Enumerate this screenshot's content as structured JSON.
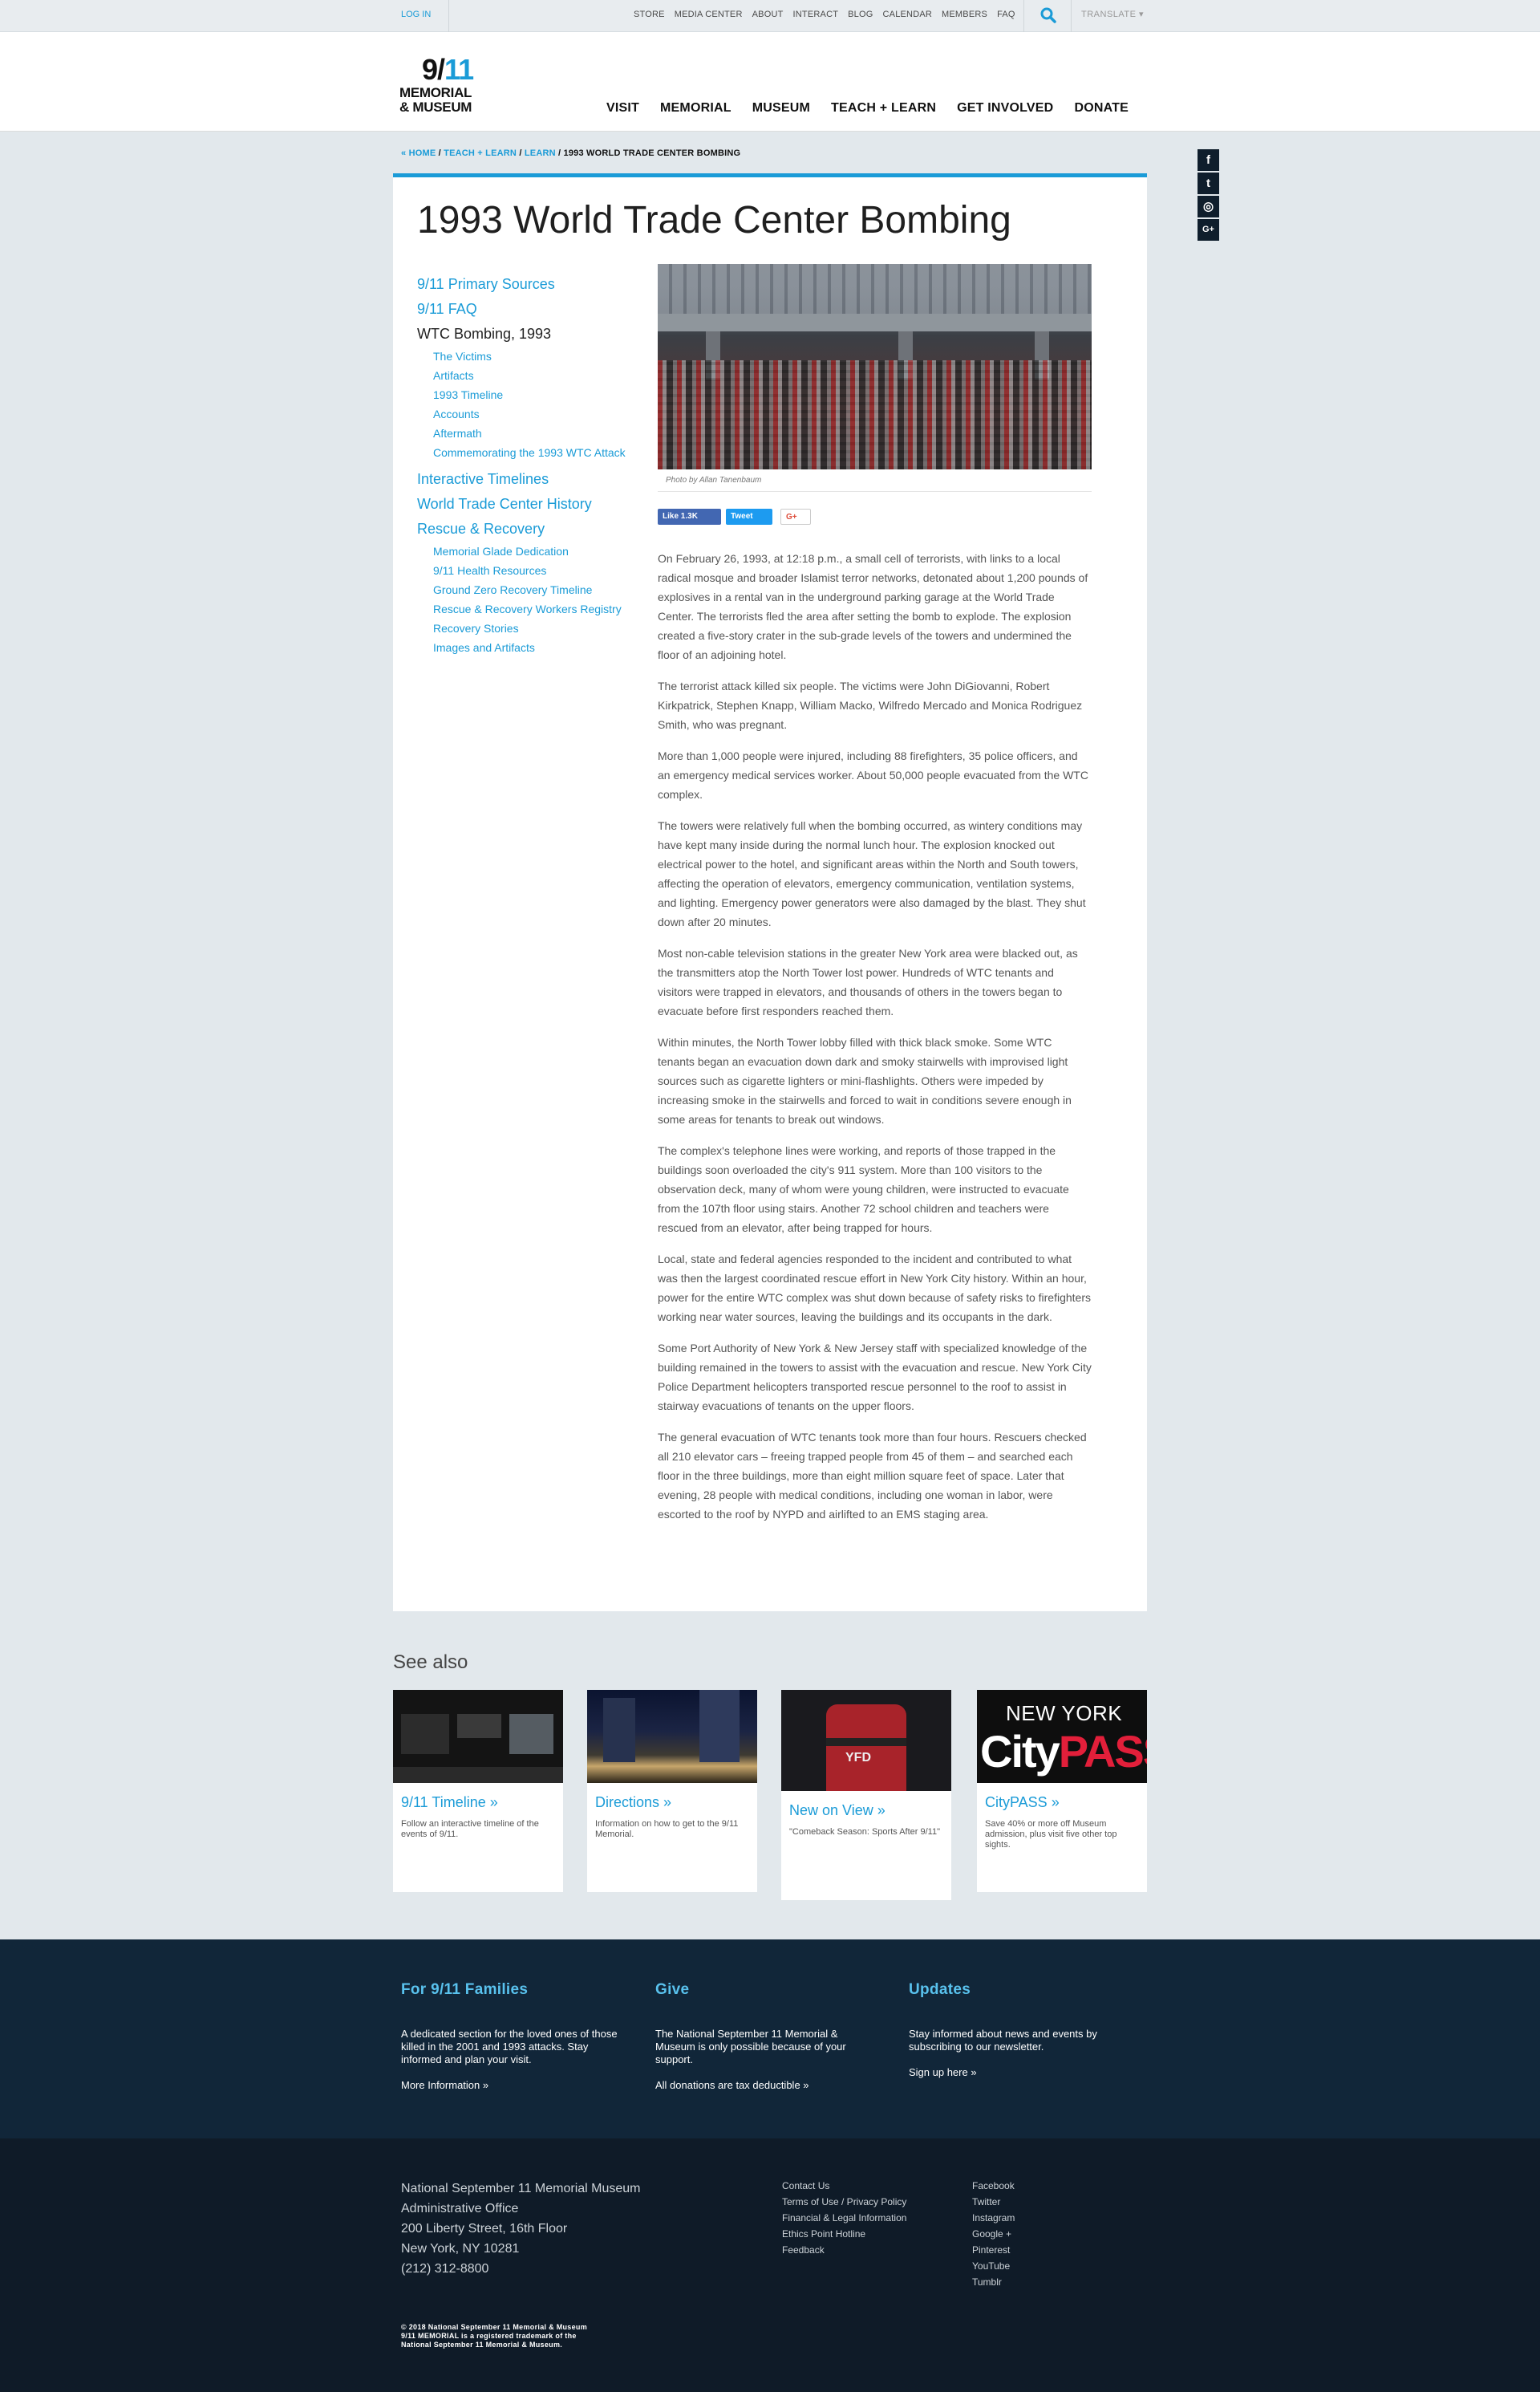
{
  "utility": {
    "login": "LOG IN",
    "links": [
      "STORE",
      "MEDIA CENTER",
      "ABOUT",
      "INTERACT",
      "BLOG",
      "CALENDAR",
      "MEMBERS",
      "FAQ"
    ],
    "translate": "TRANSLATE ▾"
  },
  "logo": {
    "line0": "9/11",
    "line1": "MEMORIAL",
    "line2": "& MUSEUM"
  },
  "nav": [
    "VISIT",
    "MEMORIAL",
    "MUSEUM",
    "TEACH + LEARN",
    "GET INVOLVED",
    "DONATE"
  ],
  "breadcrumb": {
    "home": "« HOME",
    "teach": "TEACH + LEARN",
    "learn": "LEARN",
    "current": "1993 WORLD TRADE CENTER BOMBING",
    "sep": " / "
  },
  "social": [
    "f",
    "t",
    "◎",
    "G+"
  ],
  "page": {
    "title": "1993 World Trade Center Bombing"
  },
  "sidebar": {
    "primary_sources": "9/11 Primary Sources",
    "faq": "9/11 FAQ",
    "wtc_bombing": "WTC Bombing, 1993",
    "wtc_sub": [
      "The Victims",
      "Artifacts",
      "1993 Timeline",
      "Accounts",
      "Aftermath",
      "Commemorating the 1993 WTC Attack"
    ],
    "interactive": "Interactive Timelines",
    "history": "World Trade Center History",
    "rescue": "Rescue & Recovery",
    "rescue_sub": [
      "Memorial Glade Dedication",
      "9/11 Health Resources",
      "Ground Zero Recovery Timeline",
      "Rescue & Recovery Workers Registry",
      "Recovery Stories",
      "Images and Artifacts"
    ]
  },
  "article": {
    "caption": "Photo by Allan Tanenbaum",
    "share": {
      "like": "Like 1.3K",
      "tweet": "Tweet",
      "gplus": "G+"
    },
    "paragraphs": [
      "On February 26, 1993, at 12:18 p.m., a small cell of terrorists, with links to a local radical mosque and broader Islamist terror networks, detonated about 1,200 pounds of explosives in a rental van in the underground parking garage at the World Trade Center. The terrorists fled the area after setting the bomb to explode. The explosion created a five-story crater in the sub-grade levels of the towers and undermined the floor of an adjoining hotel.",
      "The terrorist attack killed six people. The victims were John DiGiovanni, Robert Kirkpatrick, Stephen Knapp, William Macko, Wilfredo Mercado and Monica Rodriguez Smith, who was pregnant.",
      "More than 1,000 people were injured, including 88 firefighters, 35 police officers, and an emergency medical services worker. About 50,000 people evacuated from the WTC complex.",
      "The towers were relatively full when the bombing occurred, as wintery conditions may have kept many inside during the normal lunch hour. The explosion knocked out electrical power to the hotel, and significant areas within the North and South towers, affecting the operation of elevators, emergency communication, ventilation systems, and lighting. Emergency power generators were also damaged by the blast. They shut down after 20 minutes.",
      "Most non-cable television stations in the greater New York area were blacked out, as the transmitters atop the North Tower lost power. Hundreds of WTC tenants and visitors were trapped in elevators, and thousands of others in the towers began to evacuate before first responders reached them.",
      "Within minutes, the North Tower lobby filled with thick black smoke. Some WTC tenants began an evacuation down dark and smoky stairwells with improvised light sources such as cigarette lighters or mini-flashlights. Others were impeded by increasing smoke in the stairwells and forced to wait in conditions severe enough in some areas for tenants to break out windows.",
      "The complex's telephone lines were working, and reports of those trapped in the buildings soon overloaded the city's 911 system. More than 100 visitors to the observation deck, many of whom were young children, were instructed to evacuate from the 107th floor using stairs. Another 72 school children and teachers were rescued from an elevator, after being trapped for hours.",
      "Local, state and federal agencies responded to the incident and contributed to what was then the largest coordinated rescue effort in New York City history. Within an hour, power for the entire WTC complex was shut down because of safety risks to firefighters working near water sources, leaving the buildings and its occupants in the dark.",
      "Some Port Authority of New York & New Jersey staff with specialized knowledge of the building remained in the towers to assist with the evacuation and rescue. New York City Police Department helicopters transported rescue personnel to the roof to assist in stairway evacuations of tenants on the upper floors.",
      "The general evacuation of WTC tenants took more than four hours. Rescuers checked all 210 elevator cars – freeing trapped people from 45 of them – and searched each floor in the three buildings, more than eight million square feet of space. Later that evening, 28 people with medical conditions, including one woman in labor, were escorted to the roof by NYPD and airlifted to an EMS staging area."
    ]
  },
  "see_also": {
    "title": "See also",
    "cards": [
      {
        "title": "9/11 Timeline »",
        "desc": "Follow an interactive timeline of the events of 9/11."
      },
      {
        "title": "Directions »",
        "desc": "Information on how to get to the 9/11 Memorial."
      },
      {
        "title": "New on View »",
        "desc": "\"Comeback Season: Sports After 9/11\""
      },
      {
        "title": "CityPASS »",
        "desc": "Save 40% or more off Museum admission, plus visit five other top sights."
      }
    ],
    "citypass_logo": {
      "top": "NEW YORK",
      "city": "City",
      "pass": "PASS"
    },
    "jersey_text": "YFD"
  },
  "footer": {
    "families": {
      "title": "For 9/11 Families",
      "text": "A dedicated section for the loved ones of those killed in the 2001 and 1993 attacks. Stay informed and plan your visit.",
      "more": "More Information »"
    },
    "give": {
      "title": "Give",
      "text": "The National September 11 Memorial & Museum is only possible because of your support.",
      "more": "All donations are tax deductible »"
    },
    "updates": {
      "title": "Updates",
      "text": "Stay informed about news and events by subscribing to our newsletter.",
      "more": "Sign up here »"
    },
    "address": [
      "National September 11 Memorial Museum",
      "Administrative Office",
      "200 Liberty Street, 16th Floor",
      "New York, NY 10281",
      "(212) 312-8800"
    ],
    "links": [
      "Contact Us",
      "Terms of Use / Privacy Policy",
      "Financial & Legal Information",
      "Ethics Point Hotline",
      "Feedback"
    ],
    "socials": [
      "Facebook",
      "Twitter",
      "Instagram",
      "Google +",
      "Pinterest",
      "YouTube",
      "Tumblr"
    ],
    "copyright": [
      "© 2018 National September 11 Memorial & Museum",
      "9/11 MEMORIAL is a registered trademark of the",
      "National September 11 Memorial & Museum."
    ]
  }
}
